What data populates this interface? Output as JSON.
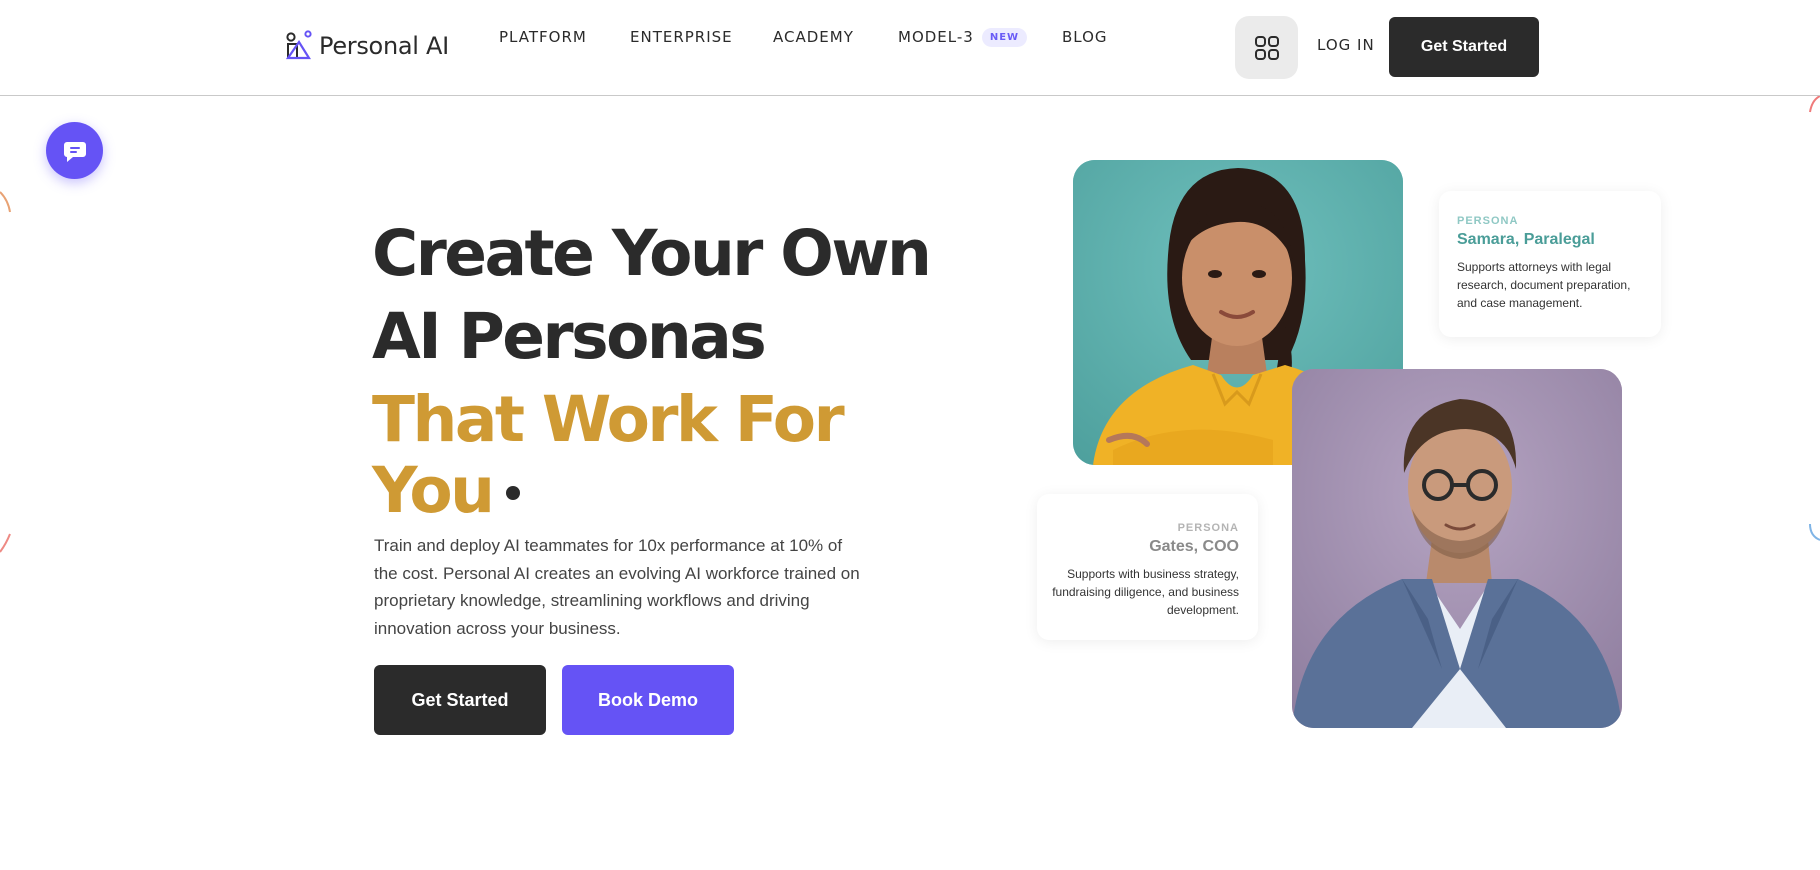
{
  "brand": {
    "name": "Personal AI",
    "accent_color": "#6553f5",
    "dark_color": "#2b2b2b",
    "gold_color": "#cf9a34",
    "teal_color": "#4a9d98"
  },
  "nav": {
    "items": [
      {
        "label": "PLATFORM"
      },
      {
        "label": "ENTERPRISE"
      },
      {
        "label": "ACADEMY"
      },
      {
        "label": "MODEL-3",
        "badge": "NEW"
      },
      {
        "label": "BLOG"
      }
    ],
    "apps_icon": "grid-icon",
    "login_label": "LOG IN",
    "cta_label": "Get Started"
  },
  "chat": {
    "icon": "chat-bubble-icon"
  },
  "hero": {
    "title_line1": "Create Your Own",
    "title_line2": "AI Personas",
    "title_line3": "That Work For",
    "title_line4": "You",
    "description": "Train and deploy AI teammates for 10x performance at 10% of the cost. Personal AI creates an evolving AI workforce trained on proprietary knowledge, streamlining workflows and driving innovation across your business.",
    "primary_cta": "Get Started",
    "secondary_cta": "Book Demo"
  },
  "personas": [
    {
      "kicker": "PERSONA",
      "name": "Samara, Paralegal",
      "description": "Supports attorneys with legal research, document preparation, and case management."
    },
    {
      "kicker": "PERSONA",
      "name": "Gates, COO",
      "description": "Supports with business strategy, fundraising diligence, and business development."
    }
  ]
}
